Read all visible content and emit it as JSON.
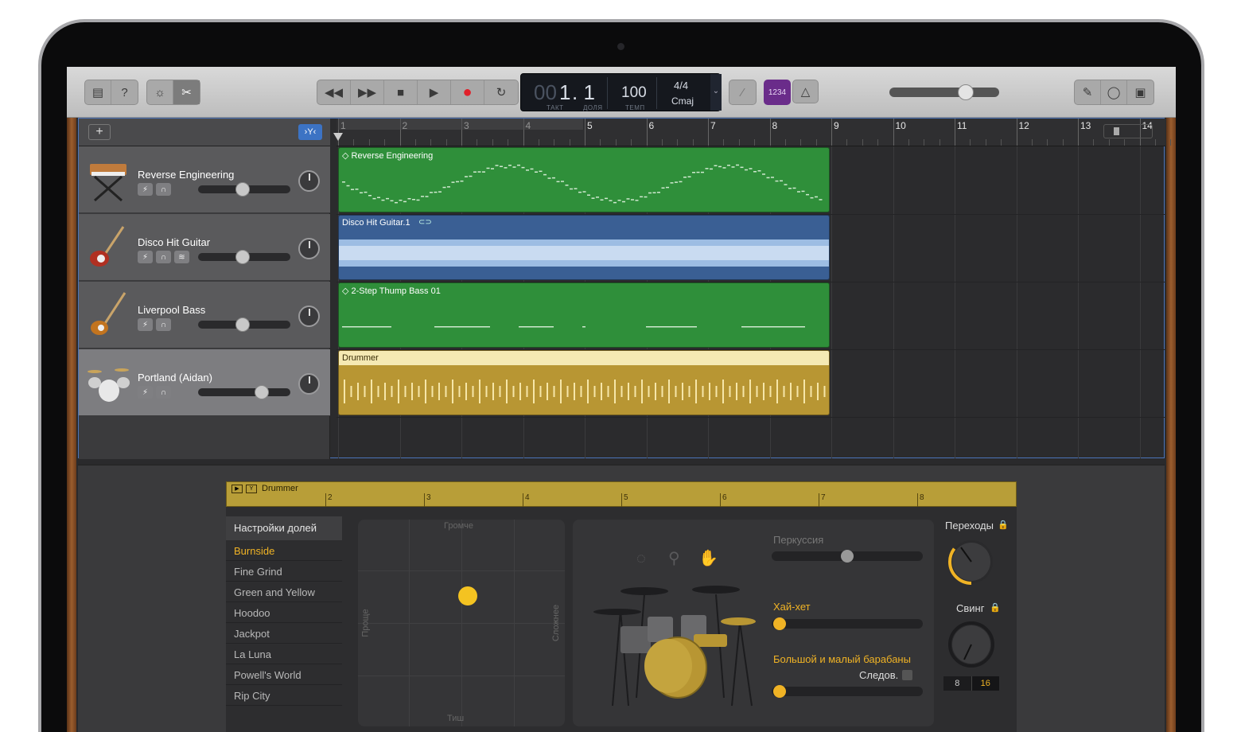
{
  "lcd": {
    "bar_prefix": "00",
    "bar": "1",
    "beat": ". 1",
    "takt_lbl": "ТАКТ",
    "dolya_lbl": "ДОЛЯ",
    "tempo": "100",
    "tempo_lbl": "ТЕМП",
    "sig": "4/4",
    "key": "Cmaj"
  },
  "count_in": "1234",
  "ruler": [
    "1",
    "2",
    "3",
    "4",
    "5",
    "6",
    "7",
    "8",
    "9",
    "10",
    "11",
    "12",
    "13",
    "14"
  ],
  "tracks": [
    {
      "name": "Reverse Engineering",
      "volume": 0.48
    },
    {
      "name": "Disco Hit Guitar",
      "volume": 0.48
    },
    {
      "name": "Liverpool Bass",
      "volume": 0.48
    },
    {
      "name": "Portland (Aidan)",
      "volume": 0.72
    }
  ],
  "regions": [
    {
      "name": "◇ Reverse Engineering",
      "color": "#2f8f3a"
    },
    {
      "name": "Disco Hit Guitar.1",
      "color": "#3a5f94"
    },
    {
      "name": "◇ 2-Step Thump Bass 01",
      "color": "#2f8f3a"
    },
    {
      "name": "Drummer",
      "color": "#b89633"
    }
  ],
  "editor": {
    "region_name": "Drummer",
    "ruler": [
      "2",
      "3",
      "4",
      "5",
      "6",
      "7",
      "8"
    ],
    "list_header": "Настройки долей",
    "beats": [
      "Burnside",
      "Fine Grind",
      "Green and Yellow",
      "Hoodoo",
      "Jackpot",
      "La Luna",
      "Powell's World",
      "Rip City"
    ],
    "xy": {
      "top": "Громче",
      "bottom": "Тиш",
      "left": "Проще",
      "right": "Сложнее",
      "puck_x": 0.53,
      "puck_y": 0.37
    },
    "percussion": {
      "label": "Перкуссия",
      "value": 0.5
    },
    "hihat": {
      "label": "Хай-хет",
      "value": 0.0
    },
    "kick_snare": {
      "label": "Большой и малый барабаны",
      "value": 0.0
    },
    "follow_label": "Следов.",
    "fills": {
      "label": "Переходы",
      "value": 0.35
    },
    "swing": {
      "label": "Свинг",
      "value": 0.55
    },
    "swing_notes": [
      "8",
      "16"
    ]
  },
  "colors": {
    "accent": "#f0b325",
    "selection": "#4b74b9"
  }
}
